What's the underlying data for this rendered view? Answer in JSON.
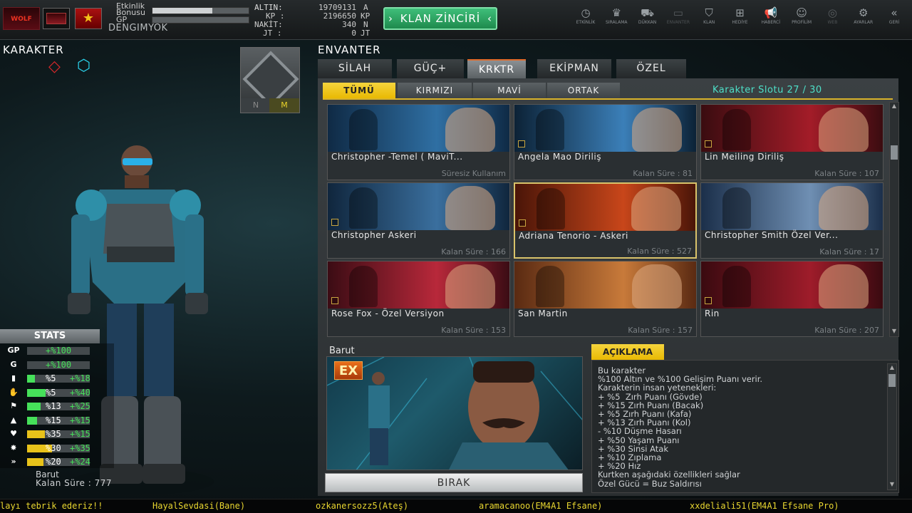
{
  "topbar": {
    "etkinlik_label": "Etkinlik",
    "bonus_label": "Bonusu",
    "etkinlik_bonus_progress": 0.62,
    "gp_label": "GP",
    "username": "DENGIMYOK",
    "resources": [
      {
        "label": "ALTIN:",
        "value": "19709131",
        "unit": "A"
      },
      {
        "label": "KP :",
        "value": "2196650",
        "unit": "KP"
      },
      {
        "label": "NAKİT:",
        "value": "340",
        "unit": "N"
      },
      {
        "label": "JT :",
        "value": "0",
        "unit": "JT"
      }
    ],
    "klan_button": "KLAN ZİNCİRİ",
    "nav": [
      {
        "label": "ETKİNLİK",
        "icon": "clock-icon",
        "glyph": "◷",
        "enabled": true
      },
      {
        "label": "SIRALAMA",
        "icon": "ranking-icon",
        "glyph": "♛",
        "enabled": true
      },
      {
        "label": "DÜKKAN",
        "icon": "cart-icon",
        "glyph": "⛟",
        "enabled": true
      },
      {
        "label": "ENVANTER",
        "icon": "inventory-icon",
        "glyph": "▭",
        "enabled": false
      },
      {
        "label": "KLAN",
        "icon": "clan-shield-icon",
        "glyph": "⛉",
        "enabled": true
      },
      {
        "label": "HEDİYE",
        "icon": "gift-icon",
        "glyph": "⊞",
        "enabled": true
      },
      {
        "label": "HABERCİ",
        "icon": "megaphone-icon",
        "glyph": "📢",
        "enabled": true
      },
      {
        "label": "PROFİLİM",
        "icon": "profile-icon",
        "glyph": "☺",
        "enabled": true
      },
      {
        "label": "WEB",
        "icon": "web-icon",
        "glyph": "◎",
        "enabled": false
      },
      {
        "label": "AYARLAR",
        "icon": "gear-icon",
        "glyph": "⚙",
        "enabled": true
      },
      {
        "label": "GERİ",
        "icon": "back-icon",
        "glyph": "«",
        "enabled": true
      }
    ]
  },
  "left": {
    "title": "KARAKTER",
    "toggle_n": "N",
    "toggle_m": "M",
    "stats_title": "STATS",
    "stats": [
      {
        "icon": "GP",
        "name": "gp",
        "base": "+%100",
        "bonus": "",
        "fill": 0.0,
        "color": "#ffffff"
      },
      {
        "icon": "G",
        "name": "g",
        "base": "+%100",
        "bonus": "",
        "fill": 0.0,
        "color": "#ffffff"
      },
      {
        "icon": "▮",
        "name": "body-armor",
        "base": "%5",
        "bonus": "+%18",
        "fill": 0.12,
        "color": "#46e05a"
      },
      {
        "icon": "✋",
        "name": "arm-armor",
        "base": "%5",
        "bonus": "+%40",
        "fill": 0.3,
        "color": "#46e05a"
      },
      {
        "icon": "⚑",
        "name": "leg-armor",
        "base": "%13",
        "bonus": "+%25",
        "fill": 0.22,
        "color": "#46e05a"
      },
      {
        "icon": "▲",
        "name": "jump",
        "base": "%15",
        "bonus": "+%15",
        "fill": 0.16,
        "color": "#46e05a"
      },
      {
        "icon": "♥",
        "name": "health",
        "base": "%35",
        "bonus": "+%15",
        "fill": 0.28,
        "color": "#e8c21a"
      },
      {
        "icon": "✸",
        "name": "critical",
        "base": "%30",
        "bonus": "+%35",
        "fill": 0.4,
        "color": "#e8c21a"
      },
      {
        "icon": "»",
        "name": "speed",
        "base": "%20",
        "bonus": "+%24",
        "fill": 0.26,
        "color": "#e8c21a"
      }
    ],
    "char_name": "Barut",
    "char_time": "Kalan Süre : 777"
  },
  "inventory": {
    "title": "ENVANTER",
    "tabs": [
      "SİLAH",
      "GÜÇ+",
      "KRKTR",
      "EKİPMAN",
      "ÖZEL"
    ],
    "active_tab": 2,
    "subtabs": [
      "TÜMÜ",
      "KIRMIZI",
      "MAVİ",
      "ORTAK"
    ],
    "active_subtab": 0,
    "slot_label": "Karakter Slotu 27 / 30",
    "cards": [
      {
        "name": "Christopher -Temel ( MaviT...",
        "time": "Süresiz Kullanım",
        "bg": [
          "#0f2a45",
          "#2f6fa3"
        ],
        "selected": false,
        "square": false
      },
      {
        "name": "Angela Mao Diriliş",
        "time": "Kalan Süre : 81",
        "bg": [
          "#0c2236",
          "#3b7fb8"
        ],
        "selected": false,
        "square": true
      },
      {
        "name": "Lin Meiling Diriliş",
        "time": "Kalan Süre : 107",
        "bg": [
          "#3a0c10",
          "#a31c28"
        ],
        "selected": false,
        "square": true
      },
      {
        "name": "Christopher Askeri",
        "time": "Kalan Süre : 166",
        "bg": [
          "#10263d",
          "#3a6f9e"
        ],
        "selected": false,
        "square": true
      },
      {
        "name": "Adriana Tenorio - Askeri",
        "time": "Kalan Süre : 527",
        "bg": [
          "#4a1508",
          "#c8461a"
        ],
        "selected": true,
        "square": true
      },
      {
        "name": "Christopher Smith Özel Ver...",
        "time": "Kalan Süre : 17",
        "bg": [
          "#1b2f4a",
          "#6f8fb3"
        ],
        "selected": false,
        "square": false
      },
      {
        "name": "Rose Fox - Özel Versiyon",
        "time": "Kalan Süre : 153",
        "bg": [
          "#3b0c14",
          "#b8283a"
        ],
        "selected": false,
        "square": true
      },
      {
        "name": "San Martin",
        "time": "Kalan Süre : 157",
        "bg": [
          "#5a2a12",
          "#c87a3a"
        ],
        "selected": false,
        "square": false
      },
      {
        "name": "Rin",
        "time": "Kalan Süre : 207",
        "bg": [
          "#3a0a10",
          "#9e1c2a"
        ],
        "selected": false,
        "square": true
      }
    ]
  },
  "detail": {
    "name": "Barut",
    "badge": "EX",
    "drop_button": "BIRAK",
    "desc_title": "AÇIKLAMA",
    "desc_lines": [
      "Bu karakter",
      "%100 Altın ve %100 Gelişim Puanı verir.",
      "Karakterin insan yetenekleri:",
      "+ %5  Zırh Puanı (Gövde)",
      "+ %15 Zırh Puanı (Bacak)",
      "+ %5 Zırh Puanı (Kafa)",
      "+ %13 Zırh Puanı (Kol)",
      "- %10 Düşme Hasarı",
      "+ %50 Yaşam Puanı",
      "+ %30 Sinsi Atak",
      "+ %10 Zıplama",
      "+ %20 Hız",
      "Kurtken aşağıdaki özellikleri sağlar",
      "Özel Gücü = Buz Saldırısı"
    ]
  },
  "ticker": [
    "layı tebrik ederiz!!",
    "HayalSevdasi(Bane)",
    "ozkanersozz5(Ateş)",
    "aramacanoo(EM4A1 Efsane)",
    "xxdeliali51(EM4A1 Efsane Pro)"
  ]
}
